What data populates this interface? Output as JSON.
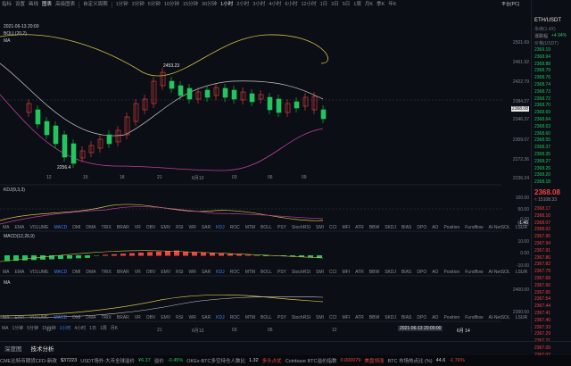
{
  "toolbar": {
    "items": [
      "指标",
      "设置",
      "画线",
      "图表",
      "高级图表",
      "自定义周期",
      "1分钟",
      "3分钟",
      "5分钟",
      "10分钟",
      "15分钟",
      "30分钟",
      "1小时",
      "2小时",
      "3小时",
      "4小时",
      "6小时",
      "12小时",
      "1日",
      "3日",
      "5日",
      "1周",
      "月K",
      "季K",
      "年K"
    ],
    "right_label": "平台(PC)"
  },
  "chart": {
    "date_label": "2021-06-13 20:00",
    "boll_label": "BOLL(20,2)",
    "ma_label": "MA",
    "annot_high": "2453.23",
    "annot_low": "2256.4",
    "price_ticks": [
      "2501.69",
      "2461.92",
      "2422.79",
      "2384.27",
      "2346.37",
      "2309.07",
      "2272.36",
      "2236.24"
    ],
    "current_price": "2368.08",
    "kdj_label": "KDJ(9,3,3)",
    "kdj_ticks": [
      "100.00",
      "50.00",
      "0.00"
    ],
    "kdj_value": "-1.46",
    "macd_label": "MACD(12,26,9)",
    "macd_ticks": [
      "10.00",
      "0.00",
      "-10.00"
    ],
    "ma2_label": "MA",
    "ma2_ticks": [
      "2400.00",
      "2300.00"
    ],
    "x_labels": [
      "12",
      "15",
      "18",
      "21",
      "6月13",
      "03",
      "06",
      "09",
      "12"
    ],
    "x_labels_top": [
      "12",
      "15",
      "18",
      "21",
      "6月13",
      "03",
      "06",
      "09",
      "12"
    ],
    "bottom_time": "2021-06-13 20:00:00",
    "bottom_date": "6月 14",
    "crosshair_left": "6月14"
  },
  "indicator_tabs": [
    "MA",
    "EMA",
    "VOLUME",
    "MACD",
    "DMI",
    "DMA",
    "TRIX",
    "BRAR",
    "VR",
    "OBV",
    "EMV",
    "RSI",
    "WR",
    "SAR",
    "KDJ",
    "ROC",
    "MTM",
    "BOLL",
    "PSY",
    "StochRSI",
    "SMI",
    "CCI",
    "MFI",
    "ATR",
    "BBW",
    "SKDJ",
    "BIAS",
    "DPO",
    "AO",
    "Position",
    "Fundflow",
    "AI-NetSOL",
    "LSUR",
    "BASIS"
  ],
  "indicator_highlight": [
    "MACD",
    "KDJ"
  ],
  "timebar": [
    "MA",
    "1分钟",
    "5分钟",
    "15分钟",
    "1小时",
    "4小时",
    "1日",
    "1周",
    "月K"
  ],
  "side": {
    "title": "ETH/USDT",
    "sub": "永续(1.4X)",
    "change_label": "涨跌幅",
    "change_value": "+4.94%",
    "price_header": "价格(USDT)",
    "asks": [
      "2369.19",
      "2368.94",
      "2368.88",
      "2368.79",
      "2368.76",
      "2368.74",
      "2368.73",
      "2368.72",
      "2368.70",
      "2368.69",
      "2368.64",
      "2368.63",
      "2368.60",
      "2368.55",
      "2368.37",
      "2368.35",
      "2368.27",
      "2368.26",
      "2368.20",
      "2368.18"
    ],
    "last": "2368.08",
    "last_sub": "≈ 15108.33",
    "bids": [
      "2368.17",
      "2368.10",
      "2368.07",
      "2368.02",
      "2367.95",
      "2367.94",
      "2367.91",
      "2367.86",
      "2367.82",
      "2367.79",
      "2367.68",
      "2367.66",
      "2367.65",
      "2367.54",
      "2367.44",
      "2367.41",
      "2367.40",
      "2367.33",
      "2367.29",
      "2367.21",
      "2367.09",
      "2367.07"
    ]
  },
  "bottom_tabs": [
    "深度图",
    "技术分析"
  ],
  "ticker": [
    {
      "label": "CME比特币期货CFD-新政",
      "value": "$37223",
      "color": "#c9ccd1"
    },
    {
      "label": "USDT场外-大币全球溢价",
      "value": "¥6.37",
      "color": "#22c55e"
    },
    {
      "label": "溢价",
      "value": "-0.45%",
      "color": "#22c55e"
    },
    {
      "label": "OKEx-BTC多空持仓人数比",
      "value": "1.32",
      "color": "#c9ccd1"
    },
    {
      "label": "多头占优",
      "value": "",
      "color": "#ef4444"
    },
    {
      "label": "Coinbase BTC溢价指数",
      "value": "0.000079",
      "color": "#ef4444"
    },
    {
      "label": "美盘领涨",
      "value": "",
      "color": "#ef4444"
    },
    {
      "label": "BTC 市场热点比 (%)",
      "value": "44.6",
      "color": "#c9ccd1"
    },
    {
      "label": "",
      "value": "-1.76%",
      "color": "#ef4444"
    }
  ],
  "colors": {
    "up": "#22c55e",
    "down": "#ef4444",
    "accent": "#3b82f6",
    "boll_up": "#d4c14a",
    "boll_mid": "#c9c9c9",
    "boll_low": "#c040a0"
  }
}
